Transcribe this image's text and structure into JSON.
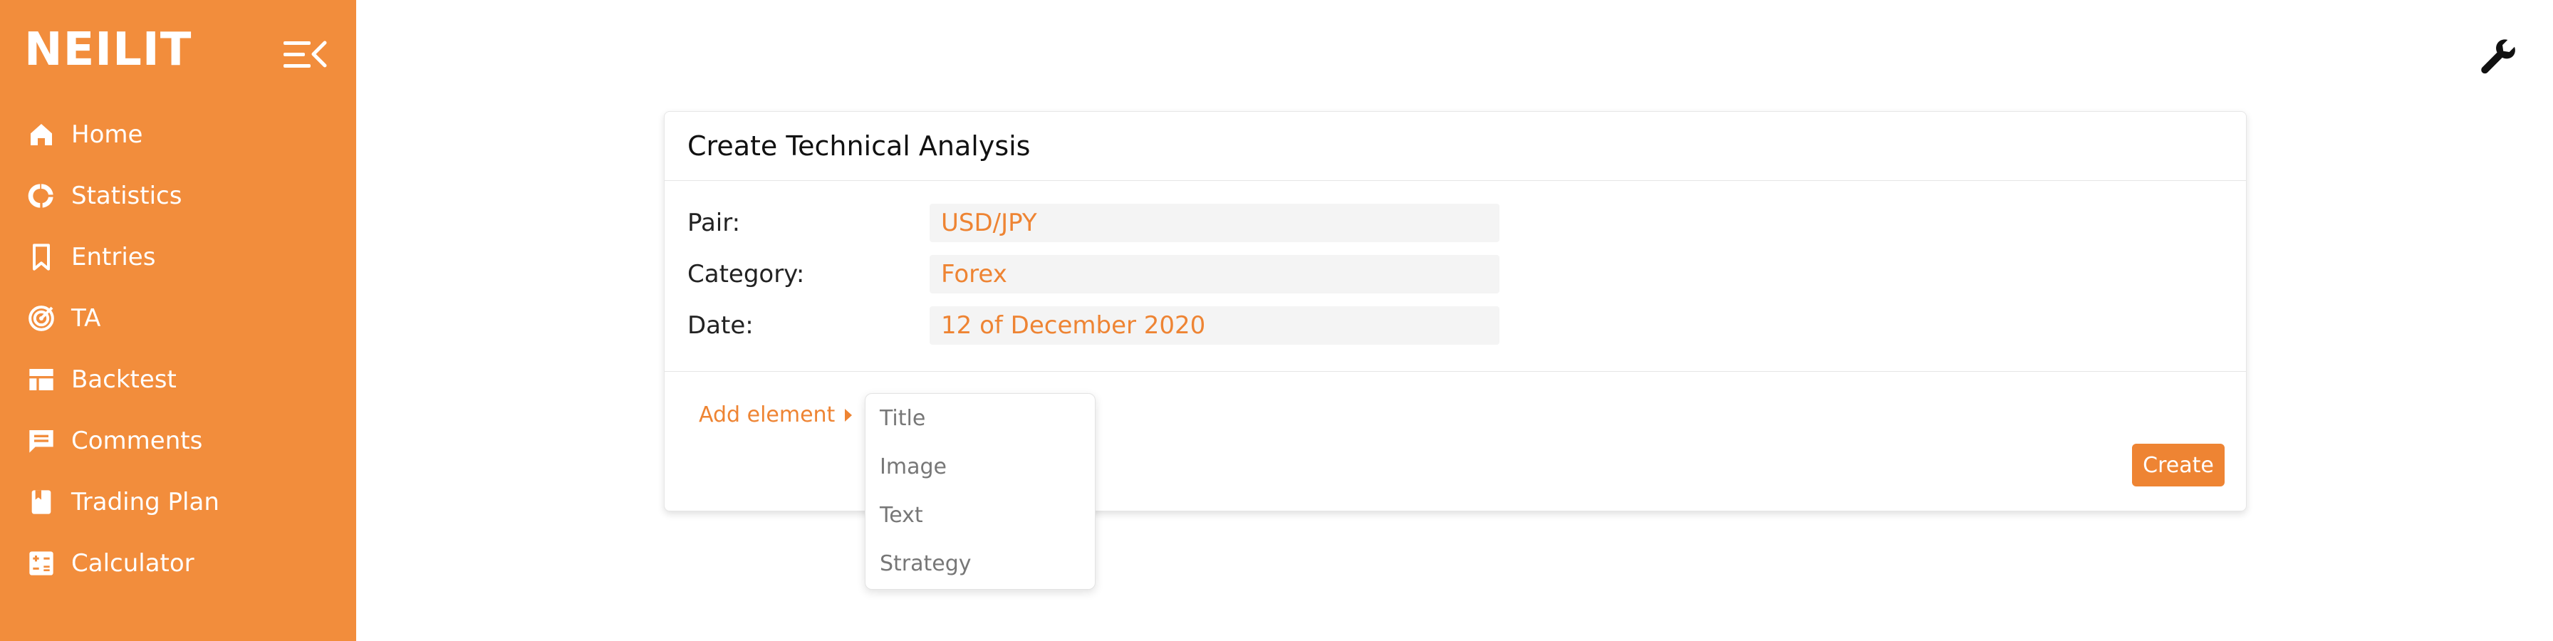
{
  "brand": "NEILIT",
  "sidebar": {
    "items": [
      {
        "label": "Home",
        "icon": "home-icon"
      },
      {
        "label": "Statistics",
        "icon": "statistics-icon"
      },
      {
        "label": "Entries",
        "icon": "bookmark-icon"
      },
      {
        "label": "TA",
        "icon": "target-icon"
      },
      {
        "label": "Backtest",
        "icon": "table-icon"
      },
      {
        "label": "Comments",
        "icon": "comment-icon"
      },
      {
        "label": "Trading Plan",
        "icon": "book-icon"
      },
      {
        "label": "Calculator",
        "icon": "calculator-icon"
      }
    ]
  },
  "card": {
    "title": "Create Technical Analysis",
    "fields": [
      {
        "label": "Pair:",
        "value": "USD/JPY"
      },
      {
        "label": "Category:",
        "value": "Forex"
      },
      {
        "label": "Date:",
        "value": "12 of December 2020"
      }
    ],
    "add_element_label": "Add element",
    "create_label": "Create"
  },
  "dropdown": {
    "options": [
      "Title",
      "Image",
      "Text",
      "Strategy"
    ]
  },
  "colors": {
    "accent": "#F28D3C",
    "accent_text": "#EE8433"
  }
}
